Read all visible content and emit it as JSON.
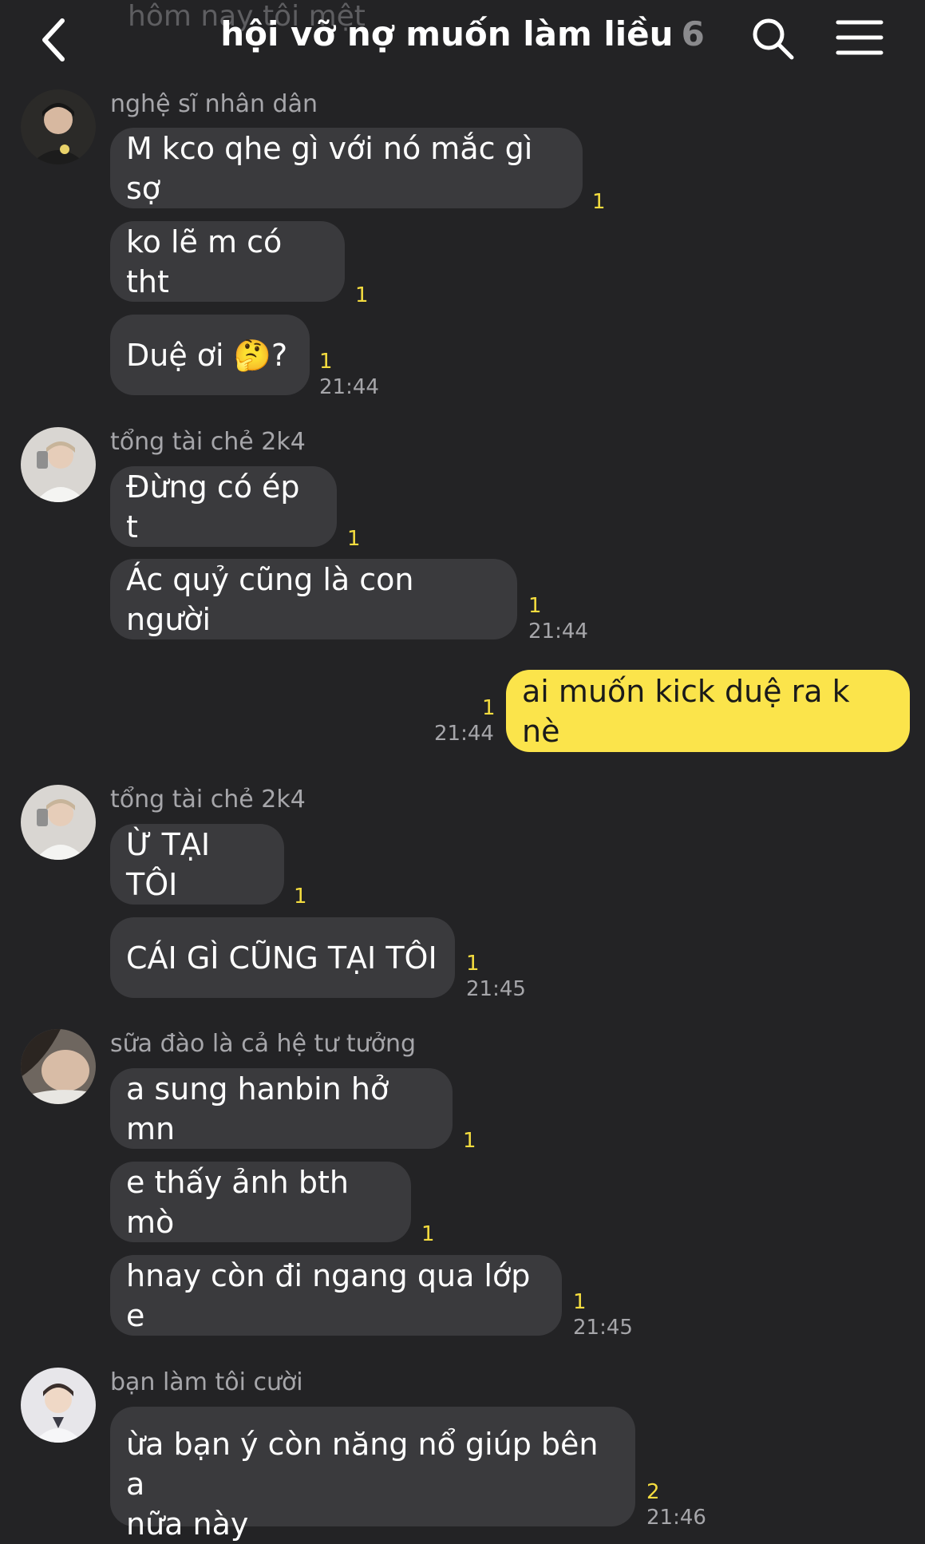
{
  "header": {
    "ghost_text": "hôm nay tôi mệt",
    "title": "hội vỡ nợ muốn làm liều",
    "member_count": "6"
  },
  "messages": [
    {
      "sender": "nghệ sĩ nhân dân",
      "texts": [
        "M kco qhe gì với nó mắc gì sợ",
        "ko lẽ m có tht",
        "Duệ ơi 🤔?"
      ],
      "counts": [
        "1",
        "1",
        "1"
      ],
      "time": "21:44"
    },
    {
      "sender": "tổng tài chẻ 2k4",
      "texts": [
        "Đừng có ép t",
        "Ác quỷ cũng là con người"
      ],
      "counts": [
        "1",
        "1"
      ],
      "time": "21:44"
    },
    {
      "mine": true,
      "texts": [
        "ai muốn kick duệ ra k nè"
      ],
      "counts": [
        "1"
      ],
      "time": "21:44"
    },
    {
      "sender": "tổng tài chẻ 2k4",
      "texts": [
        "Ừ TẠI TÔI",
        "CÁI GÌ CŨNG TẠI TÔI"
      ],
      "counts": [
        "1",
        "1"
      ],
      "time": "21:45"
    },
    {
      "sender": "sữa đào là cả hệ tư tưởng",
      "texts": [
        "a sung hanbin hở mn",
        "e thấy ảnh bth mò",
        "hnay còn đi ngang qua lớp e"
      ],
      "counts": [
        "1",
        "1",
        "1"
      ],
      "time": "21:45"
    },
    {
      "sender": "bạn làm tôi cười",
      "texts": [
        "ừa bạn ý còn năng nổ giúp bên a",
        "nữa này"
      ],
      "counts": [
        "2"
      ],
      "time": "21:46"
    }
  ],
  "colors": {
    "background": "#232325",
    "bubble_other": "#3a3a3d",
    "bubble_mine": "#fbe44b",
    "unread_count": "#f4dc3f"
  },
  "icons": [
    "back-chevron-icon",
    "search-icon",
    "menu-icon"
  ]
}
